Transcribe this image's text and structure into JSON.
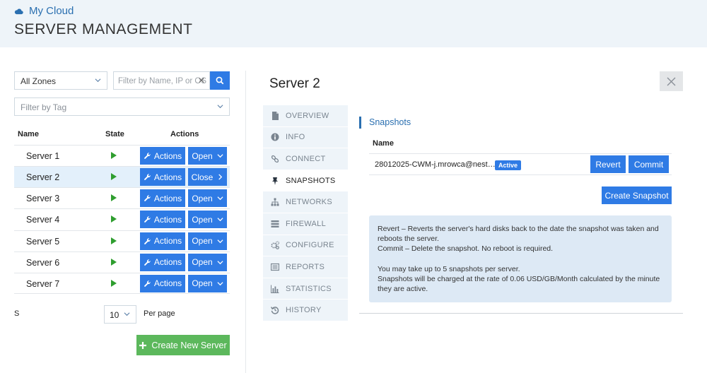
{
  "header": {
    "brand": "My Cloud",
    "title": "SERVER MANAGEMENT"
  },
  "filters": {
    "zone_value": "All Zones",
    "search_placeholder": "Filter by Name, IP or OS",
    "tag_placeholder": "Filter by Tag"
  },
  "table": {
    "headers": {
      "name": "Name",
      "state": "State",
      "actions": "Actions"
    },
    "rows": [
      {
        "name": "Server 1",
        "actions_label": "Actions",
        "toggle_label": "Open"
      },
      {
        "name": "Server 2",
        "actions_label": "Actions",
        "toggle_label": "Close"
      },
      {
        "name": "Server 3",
        "actions_label": "Actions",
        "toggle_label": "Open"
      },
      {
        "name": "Server 4",
        "actions_label": "Actions",
        "toggle_label": "Open"
      },
      {
        "name": "Server 5",
        "actions_label": "Actions",
        "toggle_label": "Open"
      },
      {
        "name": "Server 6",
        "actions_label": "Actions",
        "toggle_label": "Open"
      },
      {
        "name": "Server 7",
        "actions_label": "Actions",
        "toggle_label": "Open"
      }
    ],
    "selected_row": "Server 2"
  },
  "pagination": {
    "s_label": "S",
    "per_page_value": "10",
    "per_page_label": "Per page"
  },
  "create_server_label": "Create New Server",
  "detail": {
    "server_title": "Server 2",
    "tabs": [
      {
        "label": "OVERVIEW",
        "icon": "document-icon"
      },
      {
        "label": "INFO",
        "icon": "info-icon"
      },
      {
        "label": "CONNECT",
        "icon": "link-icon"
      },
      {
        "label": "SNAPSHOTS",
        "icon": "pin-icon"
      },
      {
        "label": "NETWORKS",
        "icon": "network-icon"
      },
      {
        "label": "FIREWALL",
        "icon": "firewall-icon"
      },
      {
        "label": "CONFIGURE",
        "icon": "gears-icon"
      },
      {
        "label": "REPORTS",
        "icon": "reports-icon"
      },
      {
        "label": "STATISTICS",
        "icon": "bar-chart-icon"
      },
      {
        "label": "HISTORY",
        "icon": "history-icon"
      }
    ],
    "active_tab": "SNAPSHOTS",
    "snapshots": {
      "heading": "Snapshots",
      "col_name": "Name",
      "items": [
        {
          "name": "28012025-CWM-j.mrowca@nest…",
          "badge": "Active",
          "revert_label": "Revert",
          "commit_label": "Commit"
        }
      ],
      "create_label": "Create Snapshot",
      "info_lines": [
        "Revert – Reverts the server's hard disks back to the date the snapshot was taken and reboots the server.",
        "Commit – Delete the snapshot. No reboot is required.",
        "You may take up to 5 snapshots per server.",
        "Snapshots will be charged at the rate of 0.06 USD/GB/Month calculated by the minute they are active."
      ]
    }
  },
  "colors": {
    "primary": "#2f7be5",
    "success": "#5cb85c",
    "header_bg": "#eef4f9",
    "selected_row": "#e3f0fb",
    "info_bg": "#dde9f5"
  }
}
